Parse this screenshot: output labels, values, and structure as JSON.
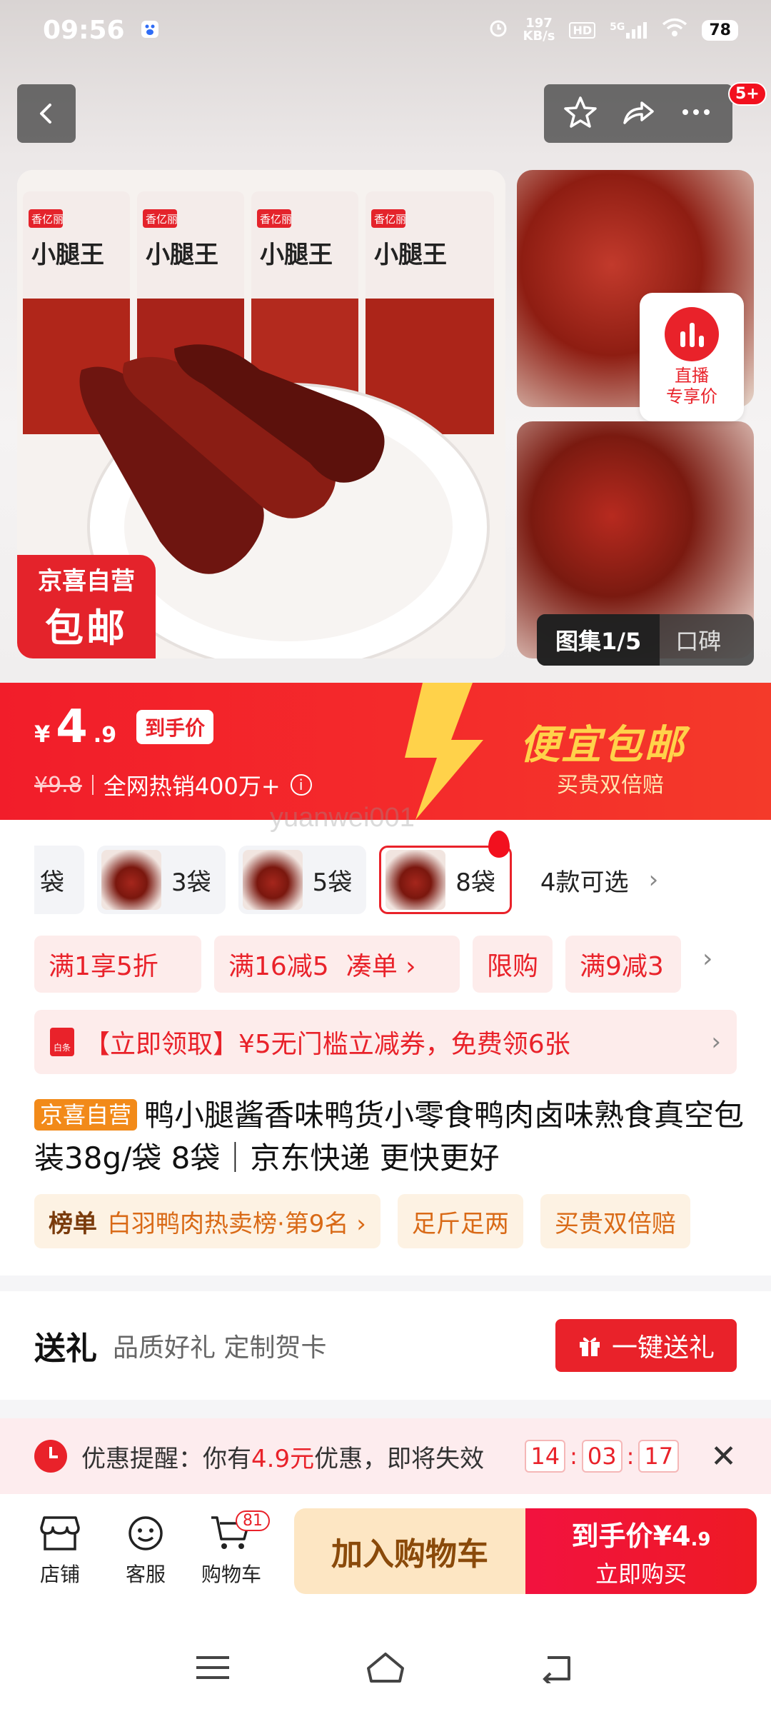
{
  "status_bar": {
    "time": "09:56",
    "net_speed_value": "197",
    "net_speed_unit": "KB/s",
    "hd": "HD",
    "signal": "5G",
    "battery": "78"
  },
  "header": {
    "cart_badge": "5+"
  },
  "gallery": {
    "free_ship_line1": "京喜自营",
    "free_ship_line2": "包邮",
    "live_line1": "直播",
    "live_line2": "专享价",
    "gallery_label": "图集1/5",
    "reviews_label": "口碑",
    "pack_brand": "香亿丽",
    "pack_title": "小腿王"
  },
  "price": {
    "symbol": "¥",
    "integer": "4",
    "decimal": ".9",
    "chip": "到手价",
    "old_price": "¥9.8",
    "sales_text": "全网热销400万+",
    "info_icon": "i",
    "banner_title": "便宜包邮",
    "banner_sub": "买贵双倍赔"
  },
  "watermark": "yuanwei001",
  "specs": {
    "partial_label": "袋",
    "items": [
      {
        "label": "3袋"
      },
      {
        "label": "5袋"
      },
      {
        "label": "8袋"
      }
    ],
    "more_label": "4款可选"
  },
  "promotions": [
    "满1享5折",
    "满16减5",
    "凑单 ›",
    "限购",
    "满9减3"
  ],
  "coupon": {
    "icon_text": "白条",
    "text": "【立即领取】¥5无门槛立减券，免费领6张"
  },
  "product": {
    "self_tag": "京喜自营",
    "title": "鸭小腿酱香味鸭货小零食鸭肉卤味熟食真空包装38g/袋 8袋｜京东快递 更快更好"
  },
  "ranks": {
    "rank_label": "榜单",
    "rank_text": "白羽鸭肉热卖榜·第9名 ›",
    "tag2": "足斤足两",
    "tag3": "买贵双倍赔"
  },
  "gift": {
    "title": "送礼",
    "desc": "品质好礼 定制贺卡",
    "button": "一键送礼"
  },
  "reminder": {
    "prefix": "优惠提醒：你有",
    "amount": "4.9元",
    "suffix": "优惠，即将失效",
    "hh": "14",
    "mm": "03",
    "ss": "17"
  },
  "bottom_bar": {
    "store": "店铺",
    "service": "客服",
    "cart": "购物车",
    "cart_count": "81",
    "add_to_cart": "加入购物车",
    "buy_label": "到手价",
    "buy_symbol": "¥",
    "buy_int": "4",
    "buy_dec": ".9",
    "buy_now": "立即购买"
  },
  "colors": {
    "accent": "#e9222a",
    "price_banner": "#f21d2a",
    "gold": "#ffd24a",
    "self_tag": "#f28a19"
  }
}
